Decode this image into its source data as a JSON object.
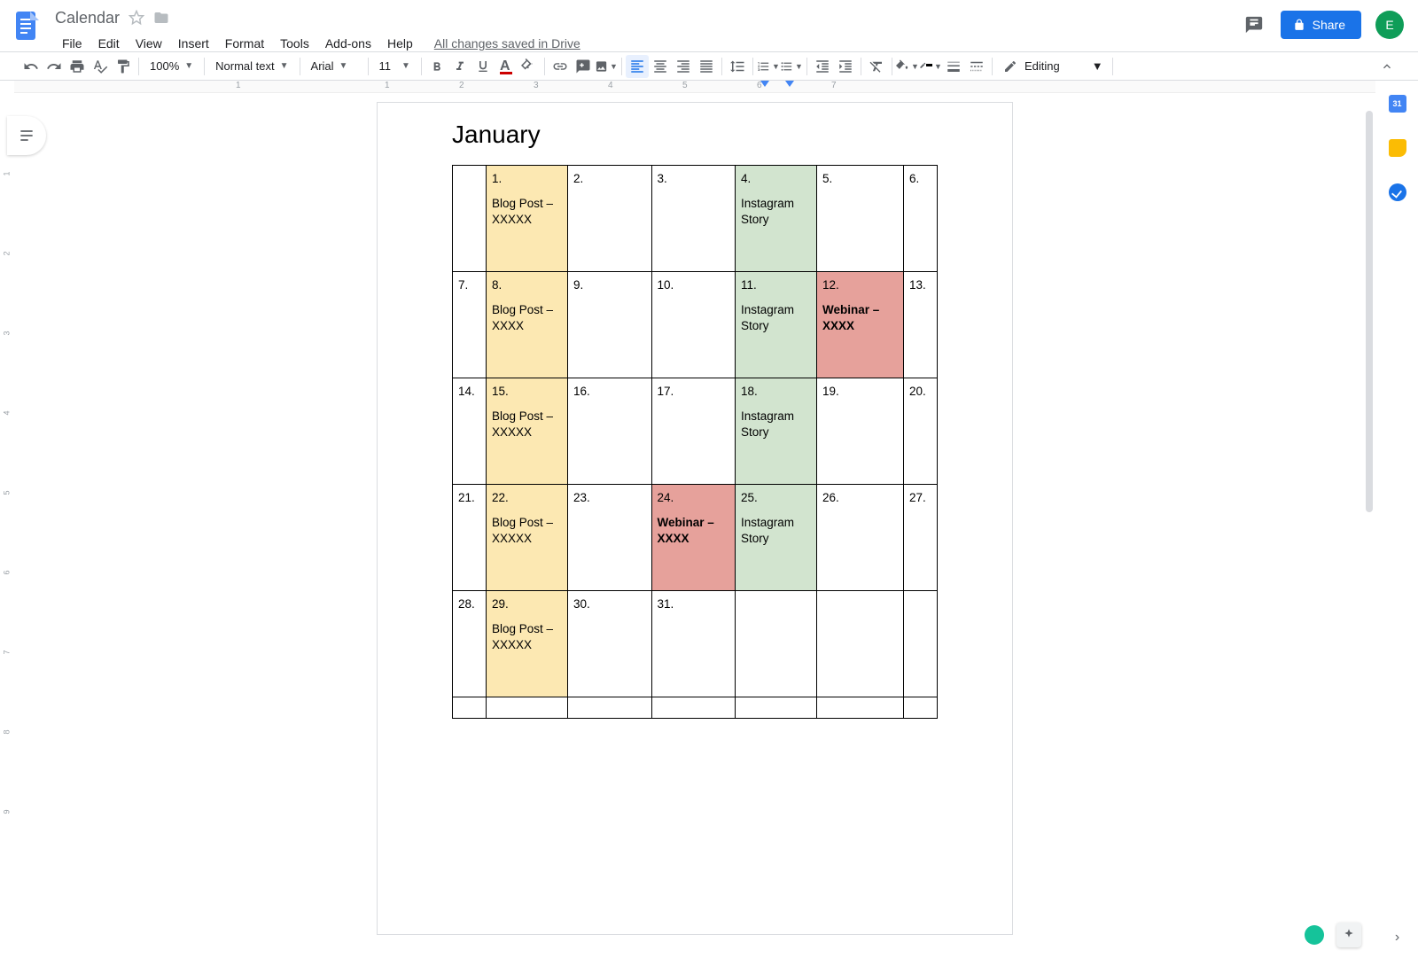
{
  "app": {
    "doc_title": "Calendar",
    "save_status": "All changes saved in Drive",
    "share_label": "Share",
    "avatar_letter": "E"
  },
  "menu": {
    "items": [
      "File",
      "Edit",
      "View",
      "Insert",
      "Format",
      "Tools",
      "Add-ons",
      "Help"
    ]
  },
  "toolbar": {
    "zoom": "100%",
    "style": "Normal text",
    "font": "Arial",
    "size": "11",
    "mode": "Editing"
  },
  "ruler": {
    "horizontal": [
      "1",
      "1",
      "2",
      "3",
      "4",
      "5",
      "6",
      "7"
    ],
    "vertical": [
      "1",
      "2",
      "3",
      "4",
      "5",
      "6",
      "7",
      "8",
      "9"
    ]
  },
  "document": {
    "heading": "January",
    "colors": {
      "yellow": "#fce8b2",
      "green": "#d2e4cf",
      "red": "#e6a19b"
    },
    "rows": [
      [
        {
          "num": "",
          "text": "",
          "color": ""
        },
        {
          "num": "1.",
          "text": "Blog Post  – XXXXX",
          "color": "yellow"
        },
        {
          "num": "2.",
          "text": "",
          "color": ""
        },
        {
          "num": "3.",
          "text": "",
          "color": ""
        },
        {
          "num": "4.",
          "text": "Instagram Story",
          "color": "green"
        },
        {
          "num": "5.",
          "text": "",
          "color": ""
        },
        {
          "num": "6.",
          "text": "",
          "color": ""
        }
      ],
      [
        {
          "num": "7.",
          "text": "",
          "color": ""
        },
        {
          "num": "8.",
          "text": "Blog Post – XXXX",
          "color": "yellow"
        },
        {
          "num": "9.",
          "text": "",
          "color": ""
        },
        {
          "num": "10.",
          "text": "",
          "color": ""
        },
        {
          "num": "11.",
          "text": "Instagram Story",
          "color": "green"
        },
        {
          "num": "12.",
          "text": "Webinar – XXXX",
          "color": "red",
          "bold": true
        },
        {
          "num": "13.",
          "text": "",
          "color": ""
        }
      ],
      [
        {
          "num": "14.",
          "text": "",
          "color": ""
        },
        {
          "num": "15.",
          "text": "Blog Post  – XXXXX",
          "color": "yellow"
        },
        {
          "num": "16.",
          "text": "",
          "color": ""
        },
        {
          "num": "17.",
          "text": "",
          "color": ""
        },
        {
          "num": "18.",
          "text": "Instagram Story",
          "color": "green"
        },
        {
          "num": "19.",
          "text": "",
          "color": ""
        },
        {
          "num": "20.",
          "text": "",
          "color": ""
        }
      ],
      [
        {
          "num": "21.",
          "text": "",
          "color": ""
        },
        {
          "num": "22.",
          "text": "Blog Post  – XXXXX",
          "color": "yellow"
        },
        {
          "num": "23.",
          "text": "",
          "color": ""
        },
        {
          "num": "24.",
          "text": "Webinar – XXXX",
          "color": "red",
          "bold": true
        },
        {
          "num": "25.",
          "text": "Instagram Story",
          "color": "green"
        },
        {
          "num": "26.",
          "text": "",
          "color": ""
        },
        {
          "num": "27.",
          "text": "",
          "color": ""
        }
      ],
      [
        {
          "num": "28.",
          "text": "",
          "color": ""
        },
        {
          "num": "29.",
          "text": "Blog Post  – XXXXX",
          "color": "yellow"
        },
        {
          "num": "30.",
          "text": "",
          "color": ""
        },
        {
          "num": "31.",
          "text": "",
          "color": ""
        },
        {
          "num": "",
          "text": "",
          "color": ""
        },
        {
          "num": "",
          "text": "",
          "color": ""
        },
        {
          "num": "",
          "text": "",
          "color": ""
        }
      ],
      [
        {
          "num": "",
          "text": "",
          "color": ""
        },
        {
          "num": "",
          "text": "",
          "color": ""
        },
        {
          "num": "",
          "text": "",
          "color": ""
        },
        {
          "num": "",
          "text": "",
          "color": ""
        },
        {
          "num": "",
          "text": "",
          "color": ""
        },
        {
          "num": "",
          "text": "",
          "color": ""
        },
        {
          "num": "",
          "text": "",
          "color": ""
        }
      ]
    ]
  }
}
